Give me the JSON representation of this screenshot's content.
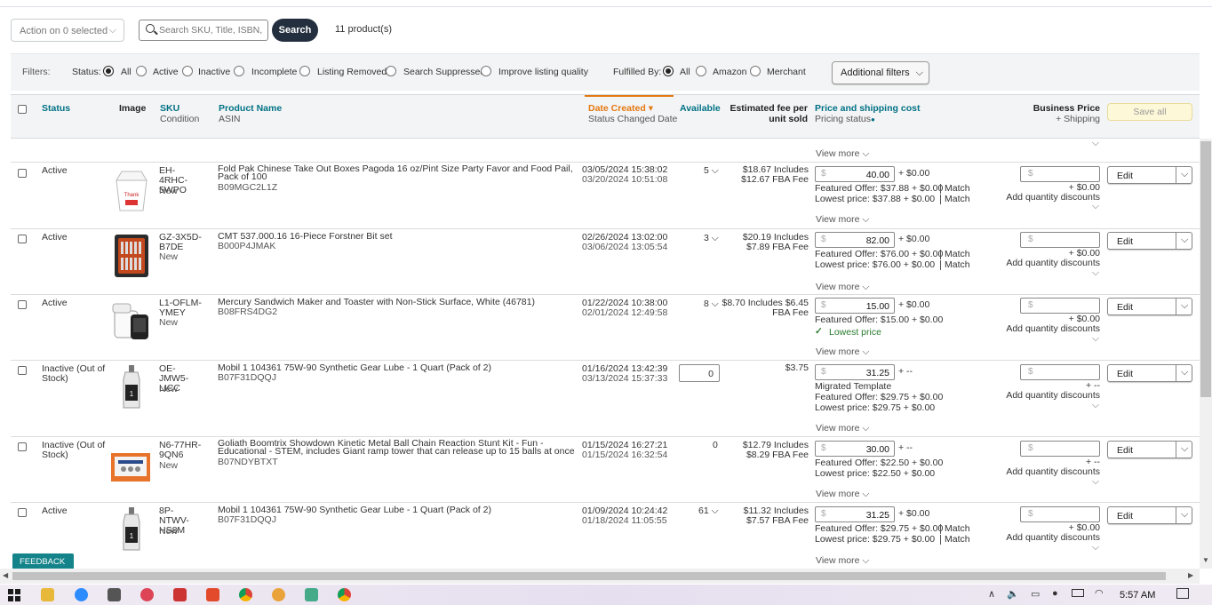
{
  "toolbar": {
    "action": "Action on 0 selected",
    "search_placeholder": "Search SKU, Title, ISBN, ASIN",
    "search_btn": "Search",
    "count": "11 product(s)"
  },
  "filters": {
    "label": "Filters:",
    "status_label": "Status:",
    "status": [
      "All",
      "Active",
      "Inactive",
      "Incomplete",
      "Listing Removed",
      "Search Suppressed",
      "Improve listing quality"
    ],
    "fulfilled_label": "Fulfilled By:",
    "fulfilled": [
      "All",
      "Amazon",
      "Merchant"
    ],
    "additional": "Additional filters"
  },
  "header": {
    "status": "Status",
    "image": "Image",
    "sku": "SKU",
    "condition": "Condition",
    "product": "Product Name",
    "asin": "ASIN",
    "date": "Date Created",
    "status_changed": "Status Changed Date",
    "available": "Available",
    "fee1": "Estimated fee per",
    "fee2": "unit sold",
    "price": "Price and shipping cost",
    "pricing_status": "Pricing status",
    "biz": "Business Price",
    "biz_ship": "+ Shipping",
    "save_all": "Save all"
  },
  "top_view_more": "View more",
  "rows": [
    {
      "status": "Active",
      "sku": "EH-4RHC-5WPO",
      "cond": "New",
      "name": "Fold Pak Chinese Take Out Boxes Pagoda 16 oz/Pint Size Party Favor and Food Pail, Pack of 100",
      "asin": "B09MGC2L1Z",
      "date1": "03/05/2024 15:38:02",
      "date2": "03/20/2024 10:51:08",
      "avail": "5",
      "fee1": "$18.67 Includes",
      "fee2": "$12.67 FBA Fee",
      "price": "40.00",
      "ship": "+ $0.00",
      "line1": "Featured Offer: $37.88 + $0.00",
      "match1": "Match",
      "line2": "Lowest price: $37.88 + $0.00",
      "match2": "Match",
      "biz_ship": "+ $0.00",
      "qd": "Add quantity discounts",
      "edit": "Edit",
      "vm": "View more"
    },
    {
      "status": "Active",
      "sku": "GZ-3X5D-B7DE",
      "cond": "New",
      "name": "CMT 537.000.16 16-Piece Forstner Bit set",
      "asin": "B000P4JMAK",
      "date1": "02/26/2024 13:02:00",
      "date2": "03/06/2024 13:05:54",
      "avail": "3",
      "fee1": "$20.19 Includes",
      "fee2": "$7.89 FBA Fee",
      "price": "82.00",
      "ship": "+ $0.00",
      "line1": "Featured Offer: $76.00 + $0.00",
      "match1": "Match",
      "line2": "Lowest price: $76.00 + $0.00",
      "match2": "Match",
      "biz_ship": "+ $0.00",
      "qd": "Add quantity discounts",
      "edit": "Edit",
      "vm": "View more"
    },
    {
      "status": "Active",
      "sku": "L1-OFLM-YMEY",
      "cond": "New",
      "name": "Mercury Sandwich Maker and Toaster with Non-Stick Surface, White (46781)",
      "asin": "B08FRS4DG2",
      "date1": "01/22/2024 10:38:00",
      "date2": "02/01/2024 12:49:58",
      "avail": "8",
      "fee1": "$8.70 Includes $6.45",
      "fee2": "FBA Fee",
      "price": "15.00",
      "ship": "+ $0.00",
      "line1": "Featured Offer: $15.00 + $0.00",
      "lowest": "Lowest price",
      "biz_ship": "+ $0.00",
      "qd": "Add quantity discounts",
      "edit": "Edit",
      "vm": "View more"
    },
    {
      "status": "Inactive (Out of Stock)",
      "sku": "OE-JMW5-LICC",
      "cond": "New",
      "name": "Mobil 1 104361 75W-90 Synthetic Gear Lube - 1 Quart (Pack of 2)",
      "asin": "B07F31DQQJ",
      "date1": "01/16/2024 13:42:39",
      "date2": "03/13/2024 15:37:33",
      "avail": "0",
      "fee1": "$3.75",
      "fee2": "",
      "price": "31.25",
      "ship": "+ --",
      "migrated": "Migrated Template",
      "line1": "Featured Offer: $29.75 + $0.00",
      "line2": "Lowest price: $29.75 + $0.00",
      "biz_ship": "+ --",
      "qd": "Add quantity discounts",
      "edit": "Edit",
      "vm": "View more"
    },
    {
      "status": "Inactive (Out of Stock)",
      "sku": "N6-77HR-9QN6",
      "cond": "New",
      "name": "Goliath Boomtrix Showdown Kinetic Metal Ball Chain Reaction Stunt Kit - Fun - Educational - STEM, includes Giant ramp tower that can release up to 15 balls at once",
      "asin": "B07NDYBTXT",
      "date1": "01/15/2024 16:27:21",
      "date2": "01/15/2024 16:32:54",
      "avail": "0",
      "fee1": "$12.79 Includes",
      "fee2": "$8.29 FBA Fee",
      "price": "30.00",
      "ship": "+ --",
      "line1": "Featured Offer: $22.50 + $0.00",
      "line2": "Lowest price: $22.50 + $0.00",
      "biz_ship": "+ --",
      "qd": "Add quantity discounts",
      "edit": "Edit",
      "vm": "View more"
    },
    {
      "status": "Active",
      "sku": "8P-NTWV-HS8M",
      "cond": "New",
      "name": "Mobil 1 104361 75W-90 Synthetic Gear Lube - 1 Quart (Pack of 2)",
      "asin": "B07F31DQQJ",
      "date1": "01/09/2024 10:24:42",
      "date2": "01/18/2024 11:05:55",
      "avail": "61",
      "fee1": "$11.32 Includes",
      "fee2": "$7.57 FBA Fee",
      "price": "31.25",
      "ship": "+ $0.00",
      "line1": "Featured Offer: $29.75 + $0.00",
      "match1": "Match",
      "line2": "Lowest price: $29.75 + $0.00",
      "match2": "Match",
      "biz_ship": "+ $0.00",
      "qd": "Add quantity discounts",
      "edit": "Edit",
      "vm": "View more"
    }
  ],
  "feedback": "FEEDBACK ✕",
  "clock": "5:57 AM"
}
